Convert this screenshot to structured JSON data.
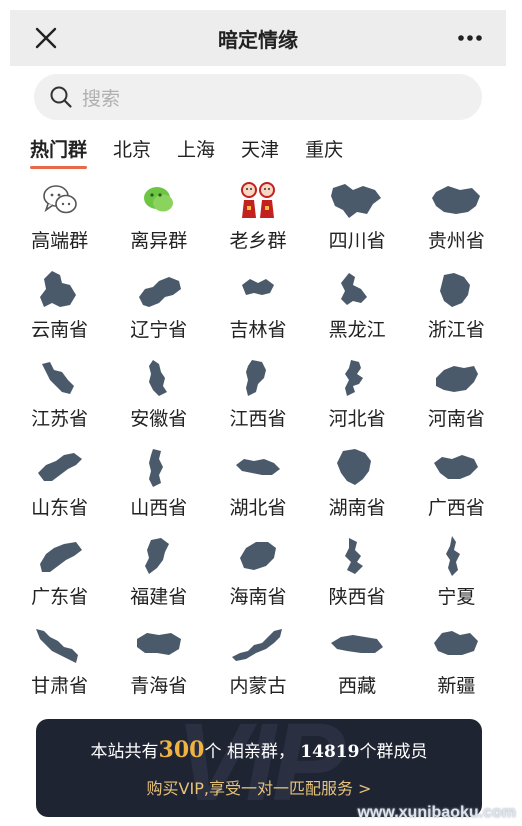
{
  "header": {
    "title": "暗定情缘",
    "close_icon": "close-icon",
    "more_icon": "more-icon"
  },
  "search": {
    "placeholder": "搜索",
    "icon": "search-icon"
  },
  "tabs": [
    {
      "label": "热门群",
      "active": true
    },
    {
      "label": "北京",
      "active": false
    },
    {
      "label": "上海",
      "active": false
    },
    {
      "label": "天津",
      "active": false
    },
    {
      "label": "重庆",
      "active": false
    }
  ],
  "groups": [
    {
      "label": "高端群",
      "icon": "chat-bubbles-icon"
    },
    {
      "label": "离异群",
      "icon": "green-chat-icon"
    },
    {
      "label": "老乡群",
      "icon": "folk-figures-icon"
    },
    {
      "label": "四川省",
      "icon": "sichuan-map-icon"
    },
    {
      "label": "贵州省",
      "icon": "guizhou-map-icon"
    },
    {
      "label": "云南省",
      "icon": "yunnan-map-icon"
    },
    {
      "label": "辽宁省",
      "icon": "liaoning-map-icon"
    },
    {
      "label": "吉林省",
      "icon": "jilin-map-icon"
    },
    {
      "label": "黑龙江",
      "icon": "heilongjiang-map-icon"
    },
    {
      "label": "浙江省",
      "icon": "zhejiang-map-icon"
    },
    {
      "label": "江苏省",
      "icon": "jiangsu-map-icon"
    },
    {
      "label": "安徽省",
      "icon": "anhui-map-icon"
    },
    {
      "label": "江西省",
      "icon": "jiangxi-map-icon"
    },
    {
      "label": "河北省",
      "icon": "hebei-map-icon"
    },
    {
      "label": "河南省",
      "icon": "henan-map-icon"
    },
    {
      "label": "山东省",
      "icon": "shandong-map-icon"
    },
    {
      "label": "山西省",
      "icon": "shanxi-map-icon"
    },
    {
      "label": "湖北省",
      "icon": "hubei-map-icon"
    },
    {
      "label": "湖南省",
      "icon": "hunan-map-icon"
    },
    {
      "label": "广西省",
      "icon": "guangxi-map-icon"
    },
    {
      "label": "广东省",
      "icon": "guangdong-map-icon"
    },
    {
      "label": "福建省",
      "icon": "fujian-map-icon"
    },
    {
      "label": "海南省",
      "icon": "hainan-map-icon"
    },
    {
      "label": "陕西省",
      "icon": "shaanxi-map-icon"
    },
    {
      "label": "宁夏",
      "icon": "ningxia-map-icon"
    },
    {
      "label": "甘肃省",
      "icon": "gansu-map-icon"
    },
    {
      "label": "青海省",
      "icon": "qinghai-map-icon"
    },
    {
      "label": "内蒙古",
      "icon": "neimenggu-map-icon"
    },
    {
      "label": "西藏",
      "icon": "xizang-map-icon"
    },
    {
      "label": "新疆",
      "icon": "xinjiang-map-icon"
    }
  ],
  "banner": {
    "prefix": "本站共有",
    "group_count": "300",
    "mid": "个 相亲群，",
    "member_count": "14819",
    "suffix": "个群成员",
    "cta": "购买VIP,享受一对一匹配服务 >",
    "watermark_text": "VIP"
  },
  "site_watermark": "www.xunibaoku.com",
  "colors": {
    "map_fill": "#4a5a6b",
    "tab_underline": "#e86a4a",
    "banner_bg": "#1f2433",
    "banner_number": "#f0b341",
    "banner_cta": "#e6c27a",
    "header_bg": "#ededed",
    "search_bg": "#f0f0f0"
  }
}
